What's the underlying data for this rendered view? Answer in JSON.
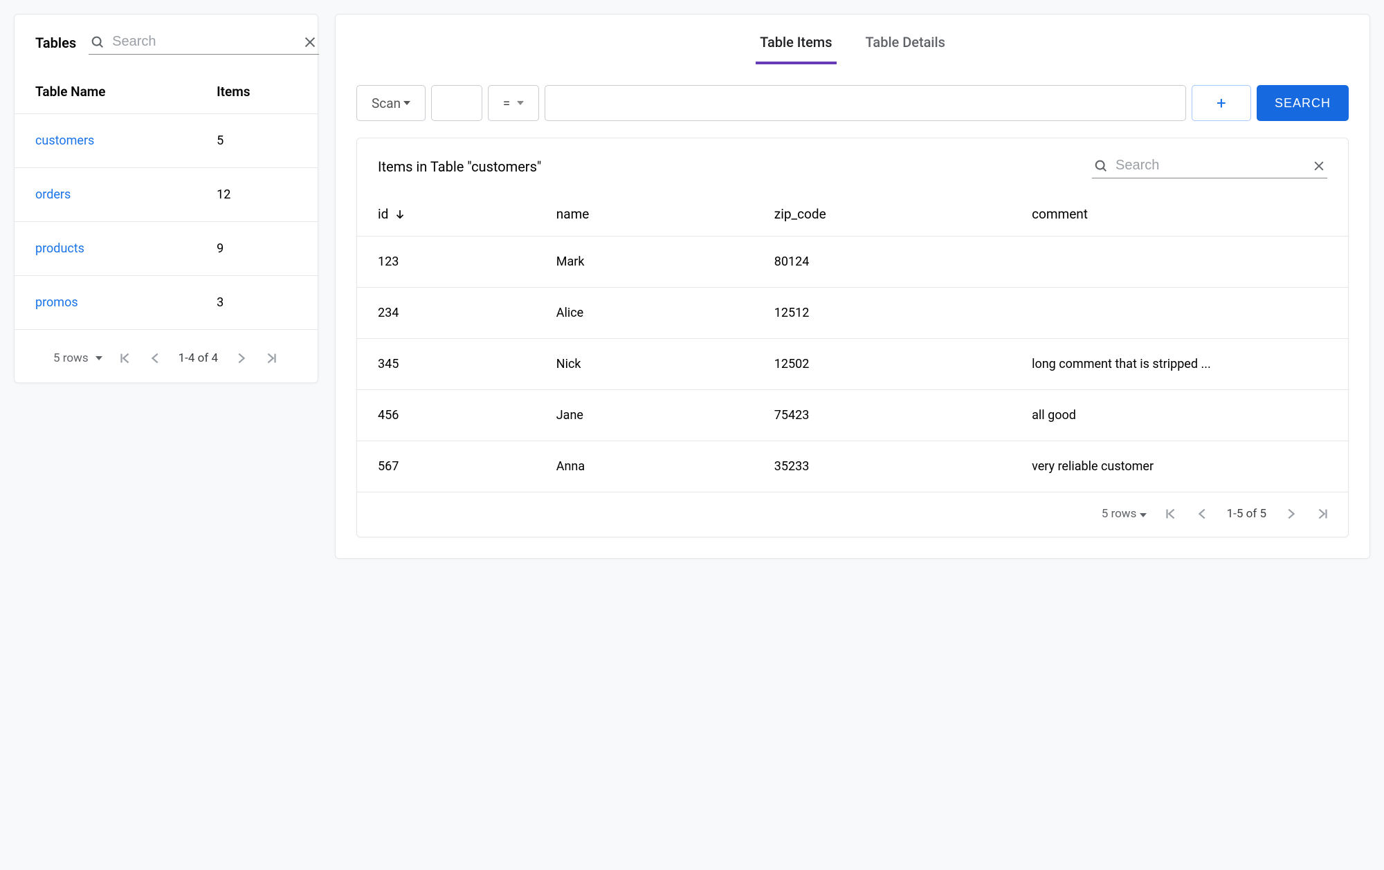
{
  "left": {
    "title": "Tables",
    "search_placeholder": "Search",
    "columns": {
      "name": "Table Name",
      "items": "Items"
    },
    "rows": [
      {
        "name": "customers",
        "items": "5"
      },
      {
        "name": "orders",
        "items": "12"
      },
      {
        "name": "products",
        "items": "9"
      },
      {
        "name": "promos",
        "items": "3"
      }
    ],
    "paginator": {
      "rows_label": "5 rows",
      "range": "1-4 of 4"
    }
  },
  "tabs": {
    "items": "Table Items",
    "details": "Table Details"
  },
  "filter": {
    "scan": "Scan",
    "op": "=",
    "add": "+",
    "search_btn": "SEARCH"
  },
  "items": {
    "title": "Items in Table \"customers\"",
    "search_placeholder": "Search",
    "columns": {
      "id": "id",
      "name": "name",
      "zip": "zip_code",
      "comment": "comment"
    },
    "rows": [
      {
        "id": "123",
        "name": "Mark",
        "zip": "80124",
        "comment": ""
      },
      {
        "id": "234",
        "name": "Alice",
        "zip": "12512",
        "comment": ""
      },
      {
        "id": "345",
        "name": "Nick",
        "zip": "12502",
        "comment": "long comment that is stripped ..."
      },
      {
        "id": "456",
        "name": "Jane",
        "zip": "75423",
        "comment": "all good"
      },
      {
        "id": "567",
        "name": "Anna",
        "zip": "35233",
        "comment": "very reliable customer"
      }
    ],
    "paginator": {
      "rows_label": "5 rows",
      "range": "1-5 of 5"
    }
  }
}
